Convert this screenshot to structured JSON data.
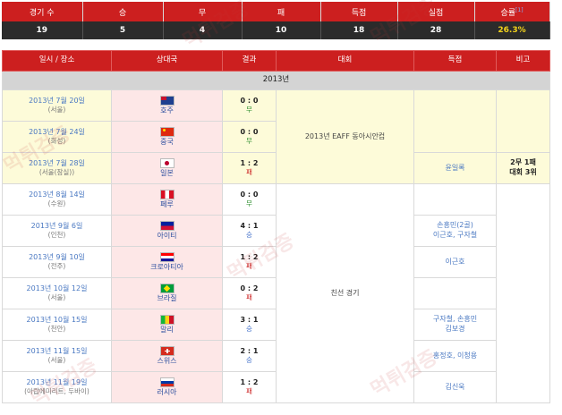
{
  "summary": {
    "headers": [
      "경기 수",
      "승",
      "무",
      "패",
      "득점",
      "실점",
      "승률"
    ],
    "rate_superscript": "[1]",
    "values": [
      "19",
      "5",
      "4",
      "10",
      "18",
      "28",
      "26.3%"
    ]
  },
  "table": {
    "headers": [
      "일시 / 장소",
      "상대국",
      "결과",
      "대회",
      "득점",
      "비고"
    ],
    "year": "2013년",
    "rows": [
      {
        "date": "2013년 7월 20일",
        "place": "(서울)",
        "opponent": "호주",
        "score": "0 : 0",
        "result": "무"
      },
      {
        "date": "2013년 7월 24일",
        "place": "(화성)",
        "opponent": "중국",
        "score": "0 : 0",
        "result": "무"
      },
      {
        "date": "2013년 7월 28일",
        "place": "(서울(잠실))",
        "opponent": "일본",
        "score": "1 : 2",
        "result": "패"
      },
      {
        "date": "2013년 8월 14일",
        "place": "(수원)",
        "opponent": "페루",
        "score": "0 : 0",
        "result": "무"
      },
      {
        "date": "2013년 9월 6일",
        "place": "(인천)",
        "opponent": "아이티",
        "score": "4 : 1",
        "result": "승"
      },
      {
        "date": "2013년 9월 10일",
        "place": "(전주)",
        "opponent": "크로아티아",
        "score": "1 : 2",
        "result": "패"
      },
      {
        "date": "2013년 10월 12일",
        "place": "(서울)",
        "opponent": "브라질",
        "score": "0 : 2",
        "result": "패"
      },
      {
        "date": "2013년 10월 15일",
        "place": "(천안)",
        "opponent": "말리",
        "score": "3 : 1",
        "result": "승"
      },
      {
        "date": "2013년 11월 15일",
        "place": "(서울)",
        "opponent": "스위스",
        "score": "2 : 1",
        "result": "승"
      },
      {
        "date": "2013년 11월 19일",
        "place": "(아랍에미리트, 두바이)",
        "opponent": "러시아",
        "score": "1 : 2",
        "result": "패"
      }
    ],
    "competition_eaff": "2013년 EAFF 동아시안컵",
    "competition_friendly": "친선 경기",
    "scorers": {
      "japan": "윤일록",
      "haiti_line1": "손흥민(2골)",
      "haiti_line2": "이근호, 구자철",
      "croatia": "이근호",
      "mali_line1": "구자철, 손흥민",
      "mali_line2": "김보경",
      "swiss": "홍정호, 이청용",
      "russia": "김신욱"
    },
    "note_line1": "2무 1패",
    "note_line2": "대회 3위"
  },
  "watermark": "먹튀검증"
}
